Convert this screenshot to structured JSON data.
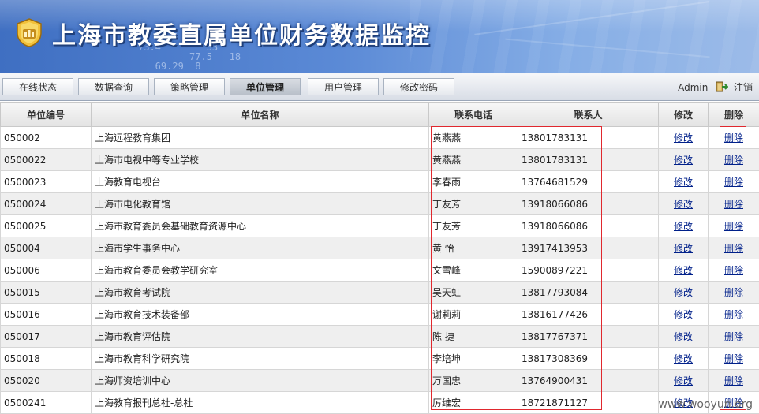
{
  "header": {
    "title": "上海市教委直属单位财务数据监控",
    "deco_numbers": "73.4        33\n         77.5   18\n   69.29  8"
  },
  "nav": {
    "tabs": [
      {
        "label": "在线状态",
        "active": false
      },
      {
        "label": "数据查询",
        "active": false
      },
      {
        "label": "策略管理",
        "active": false
      },
      {
        "label": "单位管理",
        "active": true
      },
      {
        "label": "用户管理",
        "active": false
      },
      {
        "label": "修改密码",
        "active": false
      }
    ],
    "user": "Admin",
    "logout_label": "注销"
  },
  "table": {
    "headers": [
      "单位编号",
      "单位名称",
      "联系电话",
      "联系人",
      "修改",
      "删除"
    ],
    "edit_label": "修改",
    "delete_label": "删除",
    "rows": [
      {
        "code": "050002",
        "name": "上海远程教育集团",
        "contact": "黄燕燕",
        "phone": "13801783131"
      },
      {
        "code": "0500022",
        "name": "上海市电视中等专业学校",
        "contact": "黄燕燕",
        "phone": "13801783131"
      },
      {
        "code": "0500023",
        "name": "上海教育电视台",
        "contact": "李春雨",
        "phone": "13764681529"
      },
      {
        "code": "0500024",
        "name": "上海市电化教育馆",
        "contact": "丁友芳",
        "phone": "13918066086"
      },
      {
        "code": "0500025",
        "name": "上海市教育委员会基础教育资源中心",
        "contact": "丁友芳",
        "phone": "13918066086"
      },
      {
        "code": "050004",
        "name": "上海市学生事务中心",
        "contact": "黄 怡",
        "phone": "13917413953"
      },
      {
        "code": "050006",
        "name": "上海市教育委员会教学研究室",
        "contact": "文雪峰",
        "phone": "15900897221"
      },
      {
        "code": "050015",
        "name": "上海市教育考试院",
        "contact": "吴天虹",
        "phone": "13817793084"
      },
      {
        "code": "050016",
        "name": "上海市教育技术装备部",
        "contact": "谢莉莉",
        "phone": "13816177426"
      },
      {
        "code": "050017",
        "name": "上海市教育评估院",
        "contact": "陈 捷",
        "phone": "13817767371"
      },
      {
        "code": "050018",
        "name": "上海市教育科学研究院",
        "contact": "李培坤",
        "phone": "13817308369"
      },
      {
        "code": "050020",
        "name": "上海师资培训中心",
        "contact": "万国忠",
        "phone": "13764900431"
      },
      {
        "code": "0500241",
        "name": "上海教育报刊总社-总社",
        "contact": "厉维宏",
        "phone": "18721871127"
      }
    ]
  },
  "watermark": "www.wooyun.org",
  "colors": {
    "annotation": "#e0282e",
    "link": "#00208a",
    "banner": "#4a7ccc"
  }
}
